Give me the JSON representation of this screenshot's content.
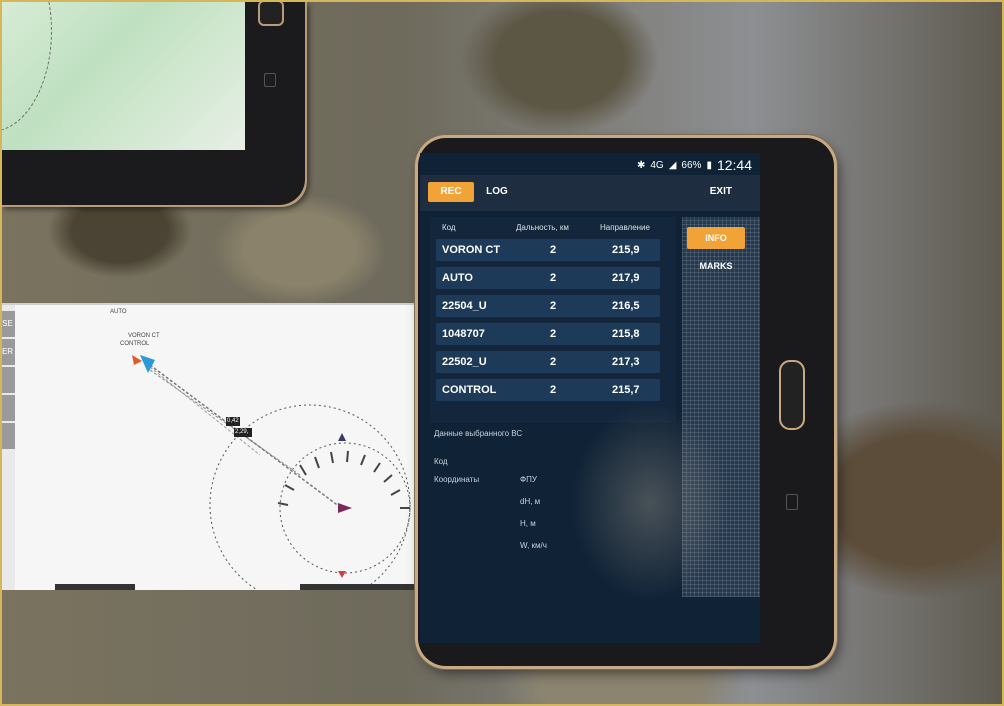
{
  "status_bar": {
    "bluetooth_icon": "bluetooth-icon",
    "network": "4G",
    "battery_pct": "66%",
    "time": "12:44"
  },
  "topbar": {
    "tabs": [
      {
        "label": "REC",
        "active": true
      },
      {
        "label": "LOG",
        "active": false
      }
    ],
    "exit_label": "EXIT"
  },
  "table": {
    "headers": [
      "Код",
      "Дальность, км",
      "Направление"
    ],
    "rows": [
      {
        "code": "VORON CT",
        "distance": "2",
        "direction": "215,9"
      },
      {
        "code": "AUTO",
        "distance": "2",
        "direction": "217,9"
      },
      {
        "code": "22504_U",
        "distance": "2",
        "direction": "216,5"
      },
      {
        "code": "1048707",
        "distance": "2",
        "direction": "215,8"
      },
      {
        "code": "22502_U",
        "distance": "2",
        "direction": "217,3"
      },
      {
        "code": "CONTROL",
        "distance": "2",
        "direction": "215,7"
      }
    ]
  },
  "details": {
    "title": "Данные выбранного ВС",
    "code_label": "Код",
    "coords_label": "Координаты",
    "fields": [
      "ФПУ",
      "dH, м",
      "H, м",
      "W, км/ч"
    ]
  },
  "side": {
    "info_label": "INFO",
    "marks_label": "MARKS"
  },
  "inset_map": {
    "side_buttons": [
      "SE",
      "ER"
    ],
    "labels": [
      "AUTO",
      "VORON CT",
      "CONTROL"
    ],
    "markers": [
      "0,42",
      "2,29,"
    ]
  },
  "colors": {
    "accent": "#f2a338",
    "screen_bg": "#0f2236",
    "row_bg": "#1d3a58"
  }
}
